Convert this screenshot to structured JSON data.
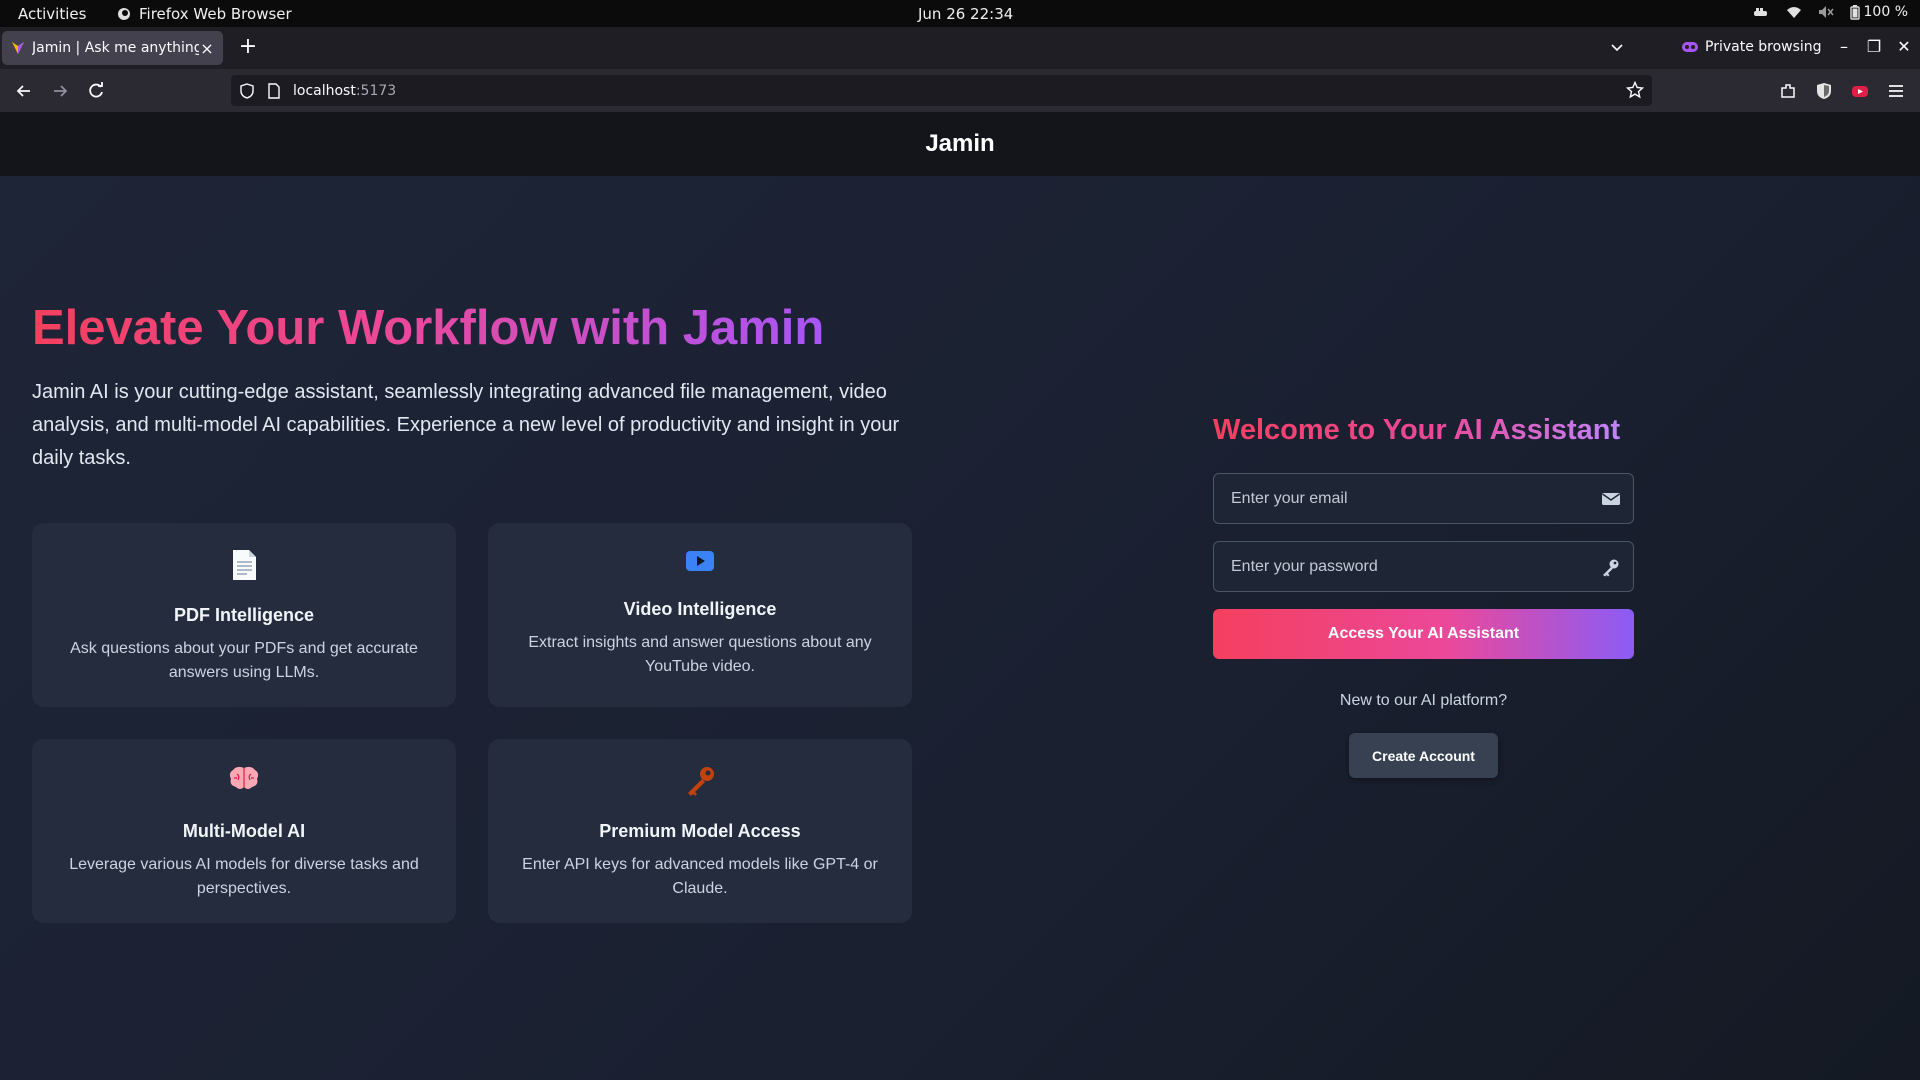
{
  "system_bar": {
    "activities": "Activities",
    "app_name": "Firefox Web Browser",
    "datetime": "Jun 26  22:34",
    "battery": "100 %"
  },
  "browser": {
    "tab_title": "Jamin | Ask me anything!",
    "private_label": "Private browsing",
    "url_host": "localhost",
    "url_port": ":5173"
  },
  "header": {
    "brand": "Jamin"
  },
  "hero": {
    "title": "Elevate Your Workflow with Jamin",
    "description": "Jamin AI is your cutting-edge assistant, seamlessly integrating advanced file management, video analysis, and multi-model AI capabilities. Experience a new level of productivity and insight in your daily tasks."
  },
  "features": [
    {
      "icon": "page-icon",
      "title": "PDF Intelligence",
      "text": "Ask questions about your PDFs and get accurate answers using LLMs."
    },
    {
      "icon": "play-button-icon",
      "title": "Video Intelligence",
      "text": "Extract insights and answer questions about any YouTube video."
    },
    {
      "icon": "brain-icon",
      "title": "Multi-Model AI",
      "text": "Leverage various AI models for diverse tasks and perspectives."
    },
    {
      "icon": "key-icon",
      "title": "Premium Model Access",
      "text": "Enter API keys for advanced models like GPT-4 or Claude."
    }
  ],
  "login": {
    "title": "Welcome to Your AI Assistant",
    "email_placeholder": "Enter your email",
    "password_placeholder": "Enter your password",
    "submit_label": "Access Your AI Assistant",
    "new_user_text": "New to our AI platform?",
    "create_label": "Create Account"
  },
  "colors": {
    "accent_start": "#f43f5e",
    "accent_mid": "#ec4899",
    "accent_end": "#8b5cf6",
    "card_bg": "#242c3d",
    "page_bg": "#1b2130"
  }
}
